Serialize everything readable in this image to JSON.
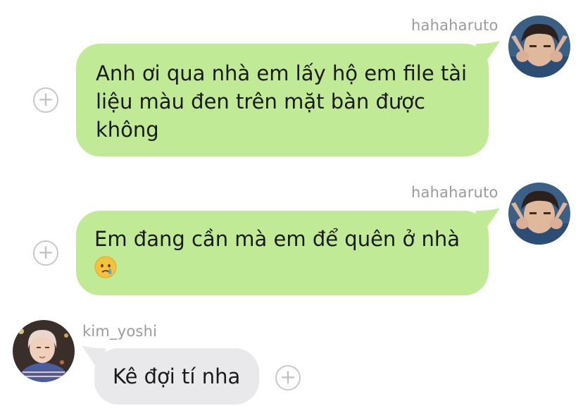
{
  "colors": {
    "outgoing_bubble": "#c0ea96",
    "incoming_bubble": "#e9e9ec",
    "username_text": "#9b9b9b",
    "message_text": "#1a1a1a"
  },
  "messages": [
    {
      "sender": "hahaharuto",
      "direction": "outgoing",
      "text": "Anh ơi qua nhà em lấy hộ em file tài liệu màu đen trên mặt bàn được không",
      "add_icon": "plus-circle-icon"
    },
    {
      "sender": "hahaharuto",
      "direction": "outgoing",
      "text": "Em đang cần mà em để quên ở nhà",
      "emoji": "crying-face-emoji",
      "add_icon": "plus-circle-icon"
    },
    {
      "sender": "kim_yoshi",
      "direction": "incoming",
      "text": "Kê đợi tí nha",
      "add_icon": "plus-circle-icon"
    }
  ],
  "add_button_glyph": "+"
}
